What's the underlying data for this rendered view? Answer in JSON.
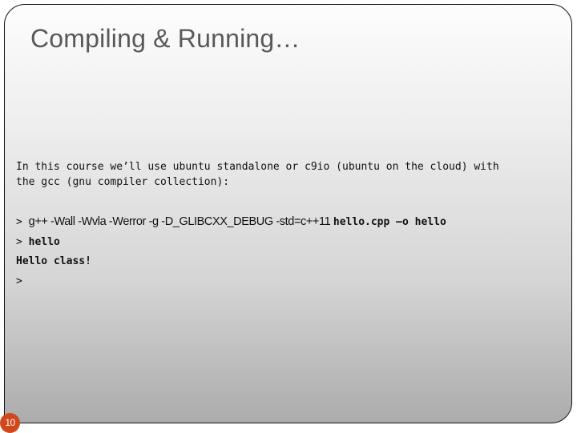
{
  "slide": {
    "title": "Compiling & Running…",
    "intro_line1": "In this course we’ll use ubuntu standalone or c9io (ubuntu on the cloud) with",
    "intro_line2": "the gcc (gnu compiler collection):",
    "terminal": {
      "compile_prompt": "> ",
      "compile_flags": "g++ -Wall -Wvla -Werror -g -D_GLIBCXX_DEBUG -std=c++11 ",
      "compile_args": "hello.cpp –o hello",
      "run_prompt": "> ",
      "run_command": "hello",
      "output": "Hello class!",
      "final_prompt": ">"
    },
    "page_number": "10",
    "accent_color": "#d0481c"
  }
}
